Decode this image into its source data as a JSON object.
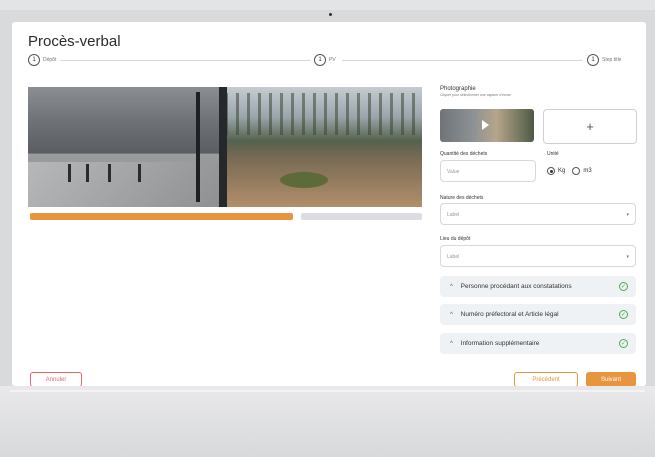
{
  "page": {
    "title": "Procès-verbal"
  },
  "stepper": {
    "steps": [
      {
        "number": "1",
        "label": "Dépôt"
      },
      {
        "number": "1",
        "label": "PV"
      },
      {
        "number": "1",
        "label": "Step title"
      }
    ]
  },
  "photos": {
    "progress_fraction": 0.67
  },
  "form": {
    "photo_label": "Photographie",
    "photo_hint": "Cliquer pour sélectionner une capture d'écran",
    "add_photo_symbol": "+",
    "quantity_label": "Quantité des déchets",
    "quantity_placeholder": "Value",
    "unit_label": "Unité",
    "unit_options": [
      {
        "label": "Kg",
        "selected": true
      },
      {
        "label": "m3",
        "selected": false
      }
    ],
    "nature_label": "Nature des déchets",
    "nature_placeholder": "Label",
    "location_label": "Lieu du dépôt",
    "location_placeholder": "Label"
  },
  "accordions": [
    {
      "label": "Personne procédant aux constatations",
      "complete": true
    },
    {
      "label": "Numéro préfectoral et Article légal",
      "complete": true
    },
    {
      "label": "Information supplémentaire",
      "complete": true
    }
  ],
  "footer": {
    "cancel_label": "Annuler",
    "previous_label": "Précédent",
    "next_label": "Suivant"
  },
  "colors": {
    "accent": "#e8963e",
    "danger": "#e56b6b",
    "success": "#4caf50"
  }
}
